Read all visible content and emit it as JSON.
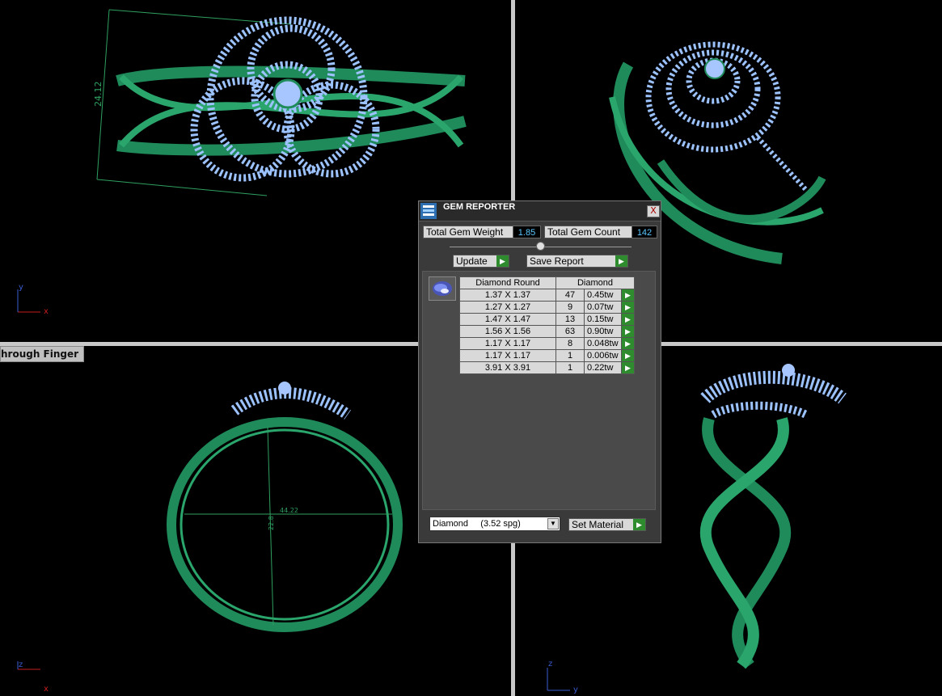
{
  "viewports": {
    "top_left": {
      "dimension_label": "24.12",
      "axis_x": "x",
      "axis_y": "y"
    },
    "top_right": {},
    "bottom_left": {
      "view_label": "hrough Finger",
      "dimension_h": "44.22",
      "dimension_v": "22.8",
      "axis_x": "x",
      "axis_y": "z"
    },
    "bottom_right": {
      "axis_x": "y",
      "axis_y": "z"
    }
  },
  "gem_reporter": {
    "title": "GEM REPORTER",
    "close_label": "X",
    "total_weight_label": "Total Gem Weight",
    "total_weight_value": "1.85",
    "total_count_label": "Total Gem Count",
    "total_count_value": "142",
    "update_label": "Update",
    "save_report_label": "Save Report",
    "table": {
      "header_shape": "Diamond Round",
      "header_material": "Diamond",
      "rows": [
        {
          "size": "1.37 X 1.37",
          "count": "47",
          "weight": "0.45tw"
        },
        {
          "size": "1.27 X 1.27",
          "count": "9",
          "weight": "0.07tw"
        },
        {
          "size": "1.47 X 1.47",
          "count": "13",
          "weight": "0.15tw"
        },
        {
          "size": "1.56 X 1.56",
          "count": "63",
          "weight": "0.90tw"
        },
        {
          "size": "1.17 X 1.17",
          "count": "8",
          "weight": "0.048tw"
        },
        {
          "size": "1.17 X 1.17",
          "count": "1",
          "weight": "0.006tw"
        },
        {
          "size": "3.91 X 3.91",
          "count": "1",
          "weight": "0.22tw"
        }
      ]
    },
    "material_select_value": "Diamond     (3.52 spg)",
    "set_material_label": "Set Material"
  },
  "colors": {
    "metal": "#1f8a5a",
    "metal_light": "#3fc78a",
    "gem": "#8fb8ff",
    "axis_red": "#c81e1e",
    "axis_blue": "#3a5bd0"
  }
}
